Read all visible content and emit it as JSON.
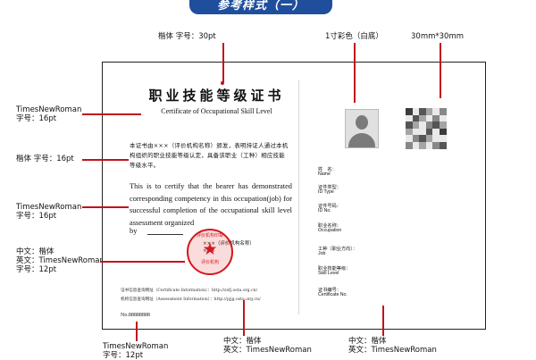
{
  "banner": "参考样式（一）",
  "annotations": {
    "top_left": "楷体 字号：30pt",
    "top_photo": "1寸彩色（白底）",
    "top_qr": "30mm*30mm",
    "left1": [
      "TimesNewRoman",
      "字号：16pt"
    ],
    "left2": "楷体 字号：16pt",
    "left3": [
      "TimesNewRoman",
      "字号：16pt"
    ],
    "left4": [
      "中文：楷体",
      "英文：TimesNewRoman",
      "字号：",
      "12pt"
    ],
    "bottom_left": [
      "TimesNewRoman",
      "字号：12pt"
    ],
    "bottom_mid": [
      "中文：楷体",
      "英文：TimesNewRoman"
    ],
    "bottom_right": [
      "中文：楷体",
      "英文：TimesNewRoman"
    ]
  },
  "certificate": {
    "title_cn": "职业技能等级证书",
    "title_en": "Certificate of Occupational Skill Level",
    "body_cn": "本证书由×××（评价机构名称）颁发，表明持证人通过本机构组织的职业技能等级认定，具备该职业（工种）相应技能等级水平。",
    "body_en": "This is to certify that the bearer has demonstrated corresponding competency in this occupation(job) for successful completion of the occupational skill level assessment organized",
    "by": "by",
    "seal_top": "评价机构印章",
    "seal_bottom": "评价机构",
    "institution_cn": "×××（评价机构名称）",
    "institution_en": "×××",
    "url1": "证书信息查询网址（Certificate Information）：http://zsfj.osta.org.cn/",
    "url2": "机构信息查询网址（Assessment Information）：http://pjjg.osta.org.cn/",
    "cert_no": "No.88888888",
    "fields": [
      {
        "cn": "姓　名：",
        "en": "Name"
      },
      {
        "cn": "证件类型：",
        "en": "ID Type"
      },
      {
        "cn": "证件号码：",
        "en": "ID No."
      },
      {
        "cn": "职业名称：",
        "en": "Occupation"
      },
      {
        "cn": "工种（职业方向）：",
        "en": "Job"
      },
      {
        "cn": "职业技能等级：",
        "en": "Skill Level"
      },
      {
        "cn": "证书编号：",
        "en": "Certificate No."
      }
    ]
  },
  "colors": {
    "banner": "#1f4e9c",
    "seal": "#d4181f",
    "pointer": "#c0141d"
  }
}
